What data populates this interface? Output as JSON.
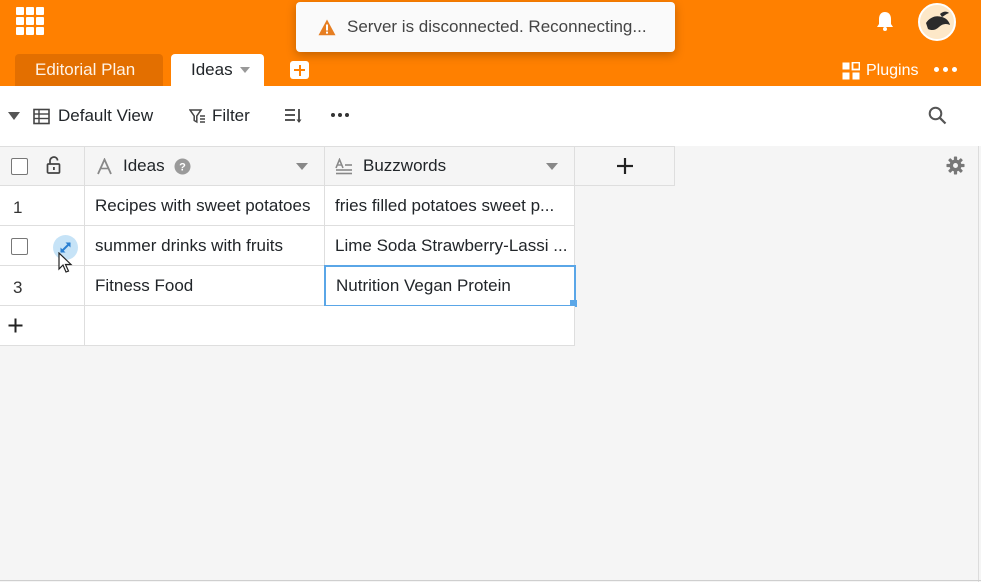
{
  "header": {
    "apps_icon": "grid-icon",
    "notification": {
      "message": "Server is disconnected. Reconnecting...",
      "icon": "warning-icon",
      "icon_color": "#e67e22"
    },
    "bell_icon": "bell-icon",
    "avatar_icon": "avatar",
    "tabs": [
      {
        "label": "Editorial Plan",
        "active": false
      },
      {
        "label": "Ideas",
        "active": true
      }
    ],
    "add_tab_icon": "plus-icon",
    "plugins_label": "Plugins",
    "more_icon": "more-horizontal-icon"
  },
  "toolbar": {
    "view_label": "Default View",
    "filter_label": "Filter",
    "sort_icon": "sort-icon",
    "more_icon": "more-horizontal-icon",
    "search_icon": "search-icon"
  },
  "table": {
    "columns": [
      {
        "name": "Ideas",
        "type_icon": "text-type-icon",
        "has_help": true
      },
      {
        "name": "Buzzwords",
        "type_icon": "long-text-type-icon",
        "has_help": false
      }
    ],
    "add_column_icon": "plus-icon",
    "rows": [
      {
        "row_label": "1",
        "cells": [
          "Recipes with sweet potatoes",
          "fries filled potatoes sweet p..."
        ]
      },
      {
        "row_label": "",
        "cells": [
          "summer drinks with fruits",
          "Lime Soda Strawberry-Lassi ..."
        ]
      },
      {
        "row_label": "3",
        "cells": [
          "Fitness Food",
          "Nutrition Vegan Protein"
        ]
      }
    ],
    "add_row_icon": "plus-icon",
    "settings_icon": "gear-icon"
  },
  "colors": {
    "brand": "#ff8000",
    "brand_dark": "#e36f00",
    "selection": "#5aa6e7"
  }
}
